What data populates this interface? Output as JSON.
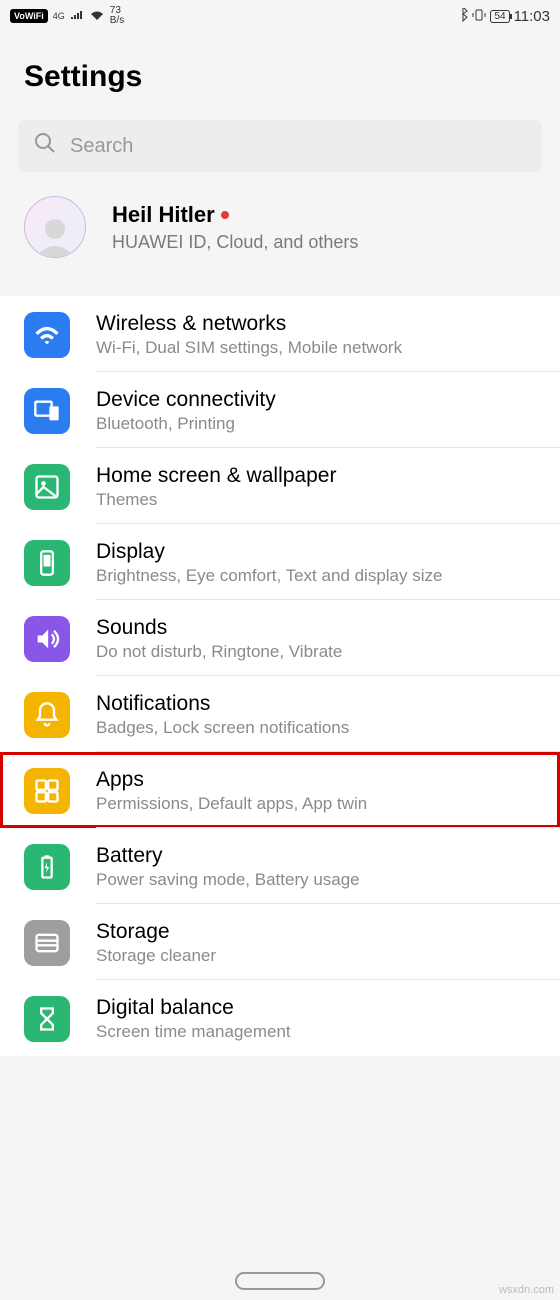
{
  "status_bar": {
    "vowifi": "VoWiFi",
    "signal": "4G",
    "speed_value": "73",
    "speed_unit": "B/s",
    "battery": "54",
    "time": "11:03"
  },
  "header": {
    "title": "Settings"
  },
  "search": {
    "placeholder": "Search"
  },
  "account": {
    "name": "Heil Hitler",
    "subtitle": "HUAWEI ID, Cloud, and others"
  },
  "rows": [
    {
      "id": "wireless",
      "title": "Wireless & networks",
      "subtitle": "Wi-Fi, Dual SIM settings, Mobile network",
      "color": "#2a7cf0",
      "icon": "wifi-icon"
    },
    {
      "id": "device",
      "title": "Device connectivity",
      "subtitle": "Bluetooth, Printing",
      "color": "#2a7cf0",
      "icon": "devices-icon"
    },
    {
      "id": "home",
      "title": "Home screen & wallpaper",
      "subtitle": "Themes",
      "color": "#2ab673",
      "icon": "image-icon"
    },
    {
      "id": "display",
      "title": "Display",
      "subtitle": "Brightness, Eye comfort, Text and display size",
      "color": "#2ab673",
      "icon": "phone-icon"
    },
    {
      "id": "sounds",
      "title": "Sounds",
      "subtitle": "Do not disturb, Ringtone, Vibrate",
      "color": "#8a56e8",
      "icon": "volume-icon"
    },
    {
      "id": "notifications",
      "title": "Notifications",
      "subtitle": "Badges, Lock screen notifications",
      "color": "#f5b400",
      "icon": "bell-icon"
    },
    {
      "id": "apps",
      "title": "Apps",
      "subtitle": "Permissions, Default apps, App twin",
      "color": "#f5b400",
      "icon": "grid-icon",
      "highlight": true
    },
    {
      "id": "battery",
      "title": "Battery",
      "subtitle": "Power saving mode, Battery usage",
      "color": "#2ab673",
      "icon": "battery-icon"
    },
    {
      "id": "storage",
      "title": "Storage",
      "subtitle": "Storage cleaner",
      "color": "#9e9e9e",
      "icon": "storage-icon"
    },
    {
      "id": "digital",
      "title": "Digital balance",
      "subtitle": "Screen time management",
      "color": "#2ab673",
      "icon": "hourglass-icon"
    }
  ],
  "watermark": "wsxdn.com"
}
